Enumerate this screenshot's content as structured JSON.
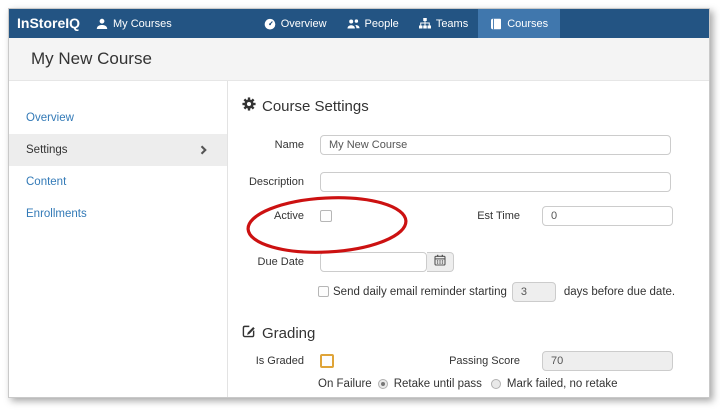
{
  "colors": {
    "navbar": "#235483",
    "navbar-active": "#4077ad",
    "link": "#337ab7",
    "annotation": "#cc1111",
    "highlight": "#dfa438"
  },
  "brand": "InStoreIQ",
  "navbar": {
    "items": [
      {
        "label": "My Courses",
        "icon": "user-icon",
        "active": false
      },
      {
        "label": "Overview",
        "icon": "dashboard-icon",
        "active": false
      },
      {
        "label": "People",
        "icon": "people-icon",
        "active": false
      },
      {
        "label": "Teams",
        "icon": "sitemap-icon",
        "active": false
      },
      {
        "label": "Courses",
        "icon": "book-icon",
        "active": true
      }
    ]
  },
  "page_title": "My New Course",
  "sidebar": {
    "items": [
      {
        "label": "Overview",
        "selected": false
      },
      {
        "label": "Settings",
        "selected": true
      },
      {
        "label": "Content",
        "selected": false
      },
      {
        "label": "Enrollments",
        "selected": false
      }
    ]
  },
  "course_settings": {
    "heading": "Course Settings",
    "name_label": "Name",
    "name_value": "My New Course",
    "description_label": "Description",
    "description_value": "",
    "active_label": "Active",
    "active_checked": false,
    "est_time_label": "Est Time",
    "est_time_value": "0",
    "due_date_label": "Due Date",
    "due_date_value": "",
    "reminder_checked": false,
    "reminder_prefix": "Send daily email reminder starting",
    "reminder_days": "3",
    "reminder_suffix": "days before due date."
  },
  "grading": {
    "heading": "Grading",
    "is_graded_label": "Is Graded",
    "is_graded_checked": false,
    "passing_score_label": "Passing Score",
    "passing_score_value": "70",
    "on_failure_label": "On Failure",
    "options": [
      {
        "label": "Retake until pass",
        "selected": true
      },
      {
        "label": "Mark failed, no retake",
        "selected": false
      }
    ]
  }
}
